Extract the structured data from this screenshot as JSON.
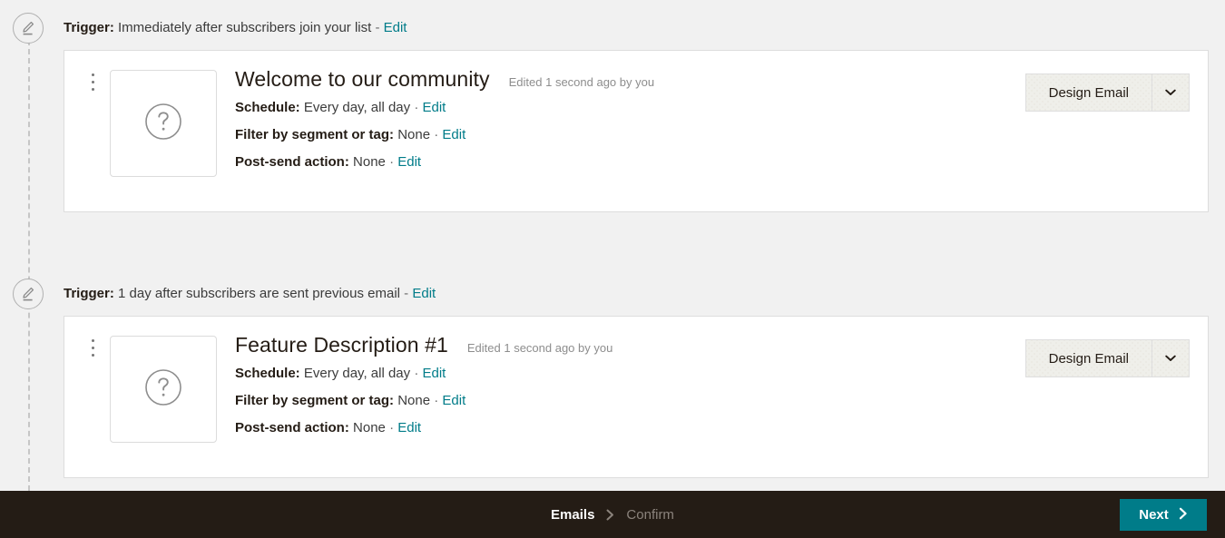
{
  "steps": [
    {
      "trigger_label": "Trigger:",
      "trigger_text": "Immediately after subscribers join your list",
      "trigger_separator": "-",
      "trigger_edit": "Edit",
      "node_icon": "pencil-icon",
      "email": {
        "title": "Welcome to our community",
        "edited_meta": "Edited 1 second ago by you",
        "thumbnail_icon": "question-mark-circle-icon",
        "menu_icon": "kebab-menu-icon",
        "meta": [
          {
            "key": "Schedule:",
            "value": "Every day, all day",
            "separator": "·",
            "edit": "Edit"
          },
          {
            "key": "Filter by segment or tag:",
            "value": "None",
            "separator": "·",
            "edit": "Edit"
          },
          {
            "key": "Post-send action:",
            "value": "None",
            "separator": "·",
            "edit": "Edit"
          }
        ],
        "design_button": "Design Email",
        "caret_icon": "chevron-down-icon"
      }
    },
    {
      "trigger_label": "Trigger:",
      "trigger_text": "1 day after subscribers are sent previous email",
      "trigger_separator": "-",
      "trigger_edit": "Edit",
      "node_icon": "pencil-icon",
      "email": {
        "title": "Feature Description #1",
        "edited_meta": "Edited 1 second ago by you",
        "thumbnail_icon": "question-mark-circle-icon",
        "menu_icon": "kebab-menu-icon",
        "meta": [
          {
            "key": "Schedule:",
            "value": "Every day, all day",
            "separator": "·",
            "edit": "Edit"
          },
          {
            "key": "Filter by segment or tag:",
            "value": "None",
            "separator": "·",
            "edit": "Edit"
          },
          {
            "key": "Post-send action:",
            "value": "None",
            "separator": "·",
            "edit": "Edit"
          }
        ],
        "design_button": "Design Email",
        "caret_icon": "chevron-down-icon"
      }
    }
  ],
  "bottom_bar": {
    "breadcrumb": [
      {
        "label": "Emails",
        "state": "active"
      },
      {
        "label": "Confirm",
        "state": "inactive"
      }
    ],
    "arrow_icon": "chevron-right-icon",
    "next_label": "Next",
    "next_icon": "chevron-right-icon"
  },
  "colors": {
    "accent": "#007c89",
    "bottom_bar_bg": "#241c15",
    "page_bg": "#f1f1f1",
    "card_bg": "#ffffff",
    "button_bg": "#efefea",
    "muted_text": "#8d8d8d"
  }
}
